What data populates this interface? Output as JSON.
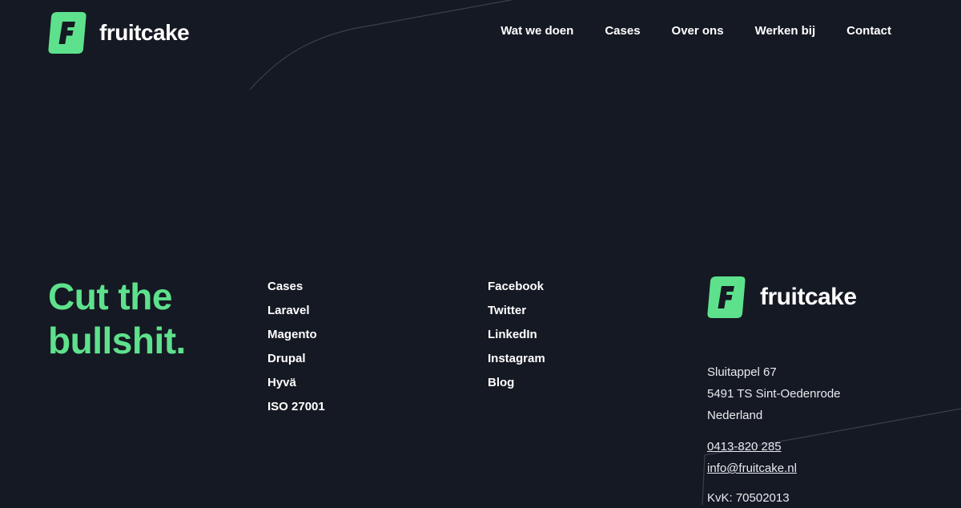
{
  "brand": {
    "name": "fruitcake",
    "accent_color": "#5ee18c",
    "background_color": "#151923",
    "logo_icon": "fruitcake-f-logo-icon"
  },
  "nav": {
    "items": [
      {
        "label": "Wat we doen"
      },
      {
        "label": "Cases"
      },
      {
        "label": "Over ons"
      },
      {
        "label": "Werken bij"
      },
      {
        "label": "Contact"
      }
    ]
  },
  "footer": {
    "tagline": {
      "line1": "Cut the",
      "line2": "bullshit."
    },
    "services": [
      "Cases",
      "Laravel",
      "Magento",
      "Drupal",
      "Hyvä",
      "ISO 27001"
    ],
    "social": [
      "Facebook",
      "Twitter",
      "LinkedIn",
      "Instagram",
      "Blog"
    ],
    "address": {
      "street": "Sluitappel 67",
      "city": "5491 TS Sint-Oedenrode",
      "country": "Nederland"
    },
    "phone": "0413-820 285",
    "email": "info@fruitcake.nl",
    "kvk": "KvK: 70502013"
  }
}
